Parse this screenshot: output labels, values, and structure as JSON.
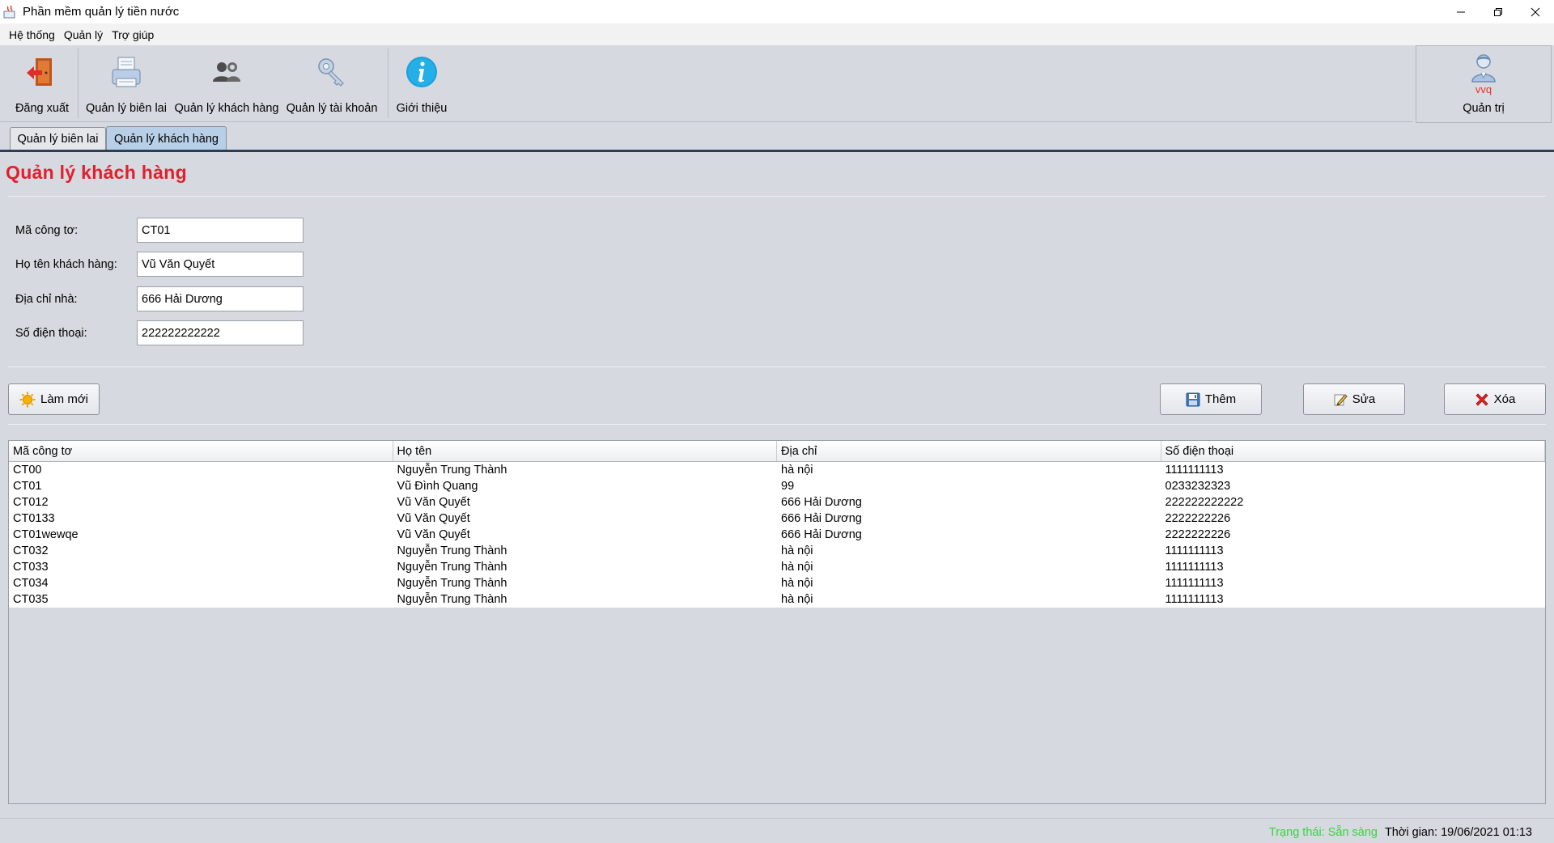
{
  "window": {
    "title": "Phần mềm quản lý tiền nước"
  },
  "menu": [
    "Hệ thống",
    "Quản lý",
    "Trợ giúp"
  ],
  "toolbar": {
    "logout": "Đăng xuất",
    "receipts": "Quản lý biên lai",
    "customers": "Quản lý khách hàng",
    "accounts": "Quản lý tài khoản",
    "about": "Giới thiệu"
  },
  "user": {
    "name": "vvq",
    "role": "Quản trị"
  },
  "tabs": [
    "Quản lý biên lai",
    "Quản lý khách hàng"
  ],
  "page": {
    "title": "Quản lý khách hàng"
  },
  "form": {
    "meter_label": "Mã công tơ:",
    "meter_value": "CT01",
    "name_label": "Họ tên khách hàng:",
    "name_value": "Vũ Văn Quyết",
    "address_label": "Địa chỉ nhà:",
    "address_value": "666 Hải Dương",
    "phone_label": "Số điện thoại:",
    "phone_value": "222222222222"
  },
  "buttons": {
    "refresh": "Làm mới",
    "add": "Thêm",
    "edit": "Sửa",
    "delete": "Xóa"
  },
  "table": {
    "columns": [
      "Mã công tơ",
      "Họ tên",
      "Địa chỉ",
      "Số điện thoại"
    ],
    "rows": [
      [
        "CT00",
        "Nguyễn Trung Thành",
        "hà nội",
        "1111111113"
      ],
      [
        "CT01",
        "Vũ Đình Quang",
        "99",
        "0233232323"
      ],
      [
        "CT012",
        "Vũ Văn Quyết",
        "666 Hải Dương",
        "222222222222"
      ],
      [
        "CT0133",
        "Vũ Văn Quyết",
        "666 Hải Dương",
        "2222222226"
      ],
      [
        "CT01wewqe",
        "Vũ Văn Quyết",
        "666 Hải Dương",
        "2222222226"
      ],
      [
        "CT032",
        "Nguyễn Trung Thành",
        "hà nội",
        "1111111113"
      ],
      [
        "CT033",
        "Nguyễn Trung Thành",
        "hà nội",
        "1111111113"
      ],
      [
        "CT034",
        "Nguyễn Trung Thành",
        "hà nội",
        "1111111113"
      ],
      [
        "CT035",
        "Nguyễn Trung Thành",
        "hà nội",
        "1111111113"
      ]
    ]
  },
  "status": {
    "state": "Trạng thái: Sẵn sàng",
    "time": "Thời gian: 19/06/2021 01:13"
  },
  "colors": {
    "title_red": "#e0202e",
    "status_green": "#35d43f",
    "active_tab": "#b8cfe8",
    "user_red": "#e8312a"
  }
}
